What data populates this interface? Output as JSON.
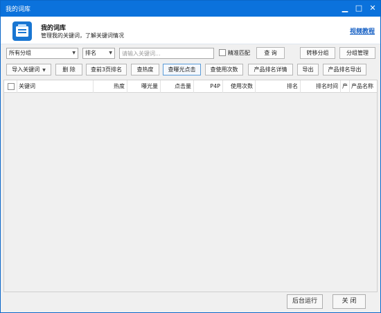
{
  "window": {
    "title": "我的词库",
    "controls": {
      "minimize": "▁",
      "maximize": "□",
      "close": "✕"
    }
  },
  "header": {
    "title": "我的词库",
    "subtitle": "管理我的关键词，了解关键词情况",
    "tutorial_link": "视频教程"
  },
  "filters": {
    "group_select": "所有分组",
    "sort_select": "排名",
    "search": {
      "value": "",
      "placeholder": "请输入关键词..."
    },
    "exact_match_label": "精准匹配",
    "exact_match_checked": false,
    "query_button": "查 询",
    "move_group_button": "转移分组",
    "group_manage_button": "分组管理"
  },
  "toolbar": {
    "import_button": "导入关键词",
    "delete_button": "删 除",
    "top3_button": "查前3页排名",
    "heat_button": "查热度",
    "exposure_button": "查曝光点击",
    "usage_button": "查使用次数",
    "product_rank_detail_button": "产品排名详情",
    "export_button": "导出",
    "export_product_rank_button": "产品排名导出"
  },
  "table": {
    "columns": [
      "关键词",
      "热度",
      "曝光量",
      "点击量",
      "P4P",
      "使用次数",
      "排名",
      "排名时间",
      "产",
      "产品名称"
    ],
    "rows": []
  },
  "footer": {
    "background_run_button": "后台运行",
    "close_button": "关 闭"
  },
  "colors": {
    "titlebar": "#0b72dc",
    "link": "#1660c4",
    "panel": "#f0f0f0"
  }
}
